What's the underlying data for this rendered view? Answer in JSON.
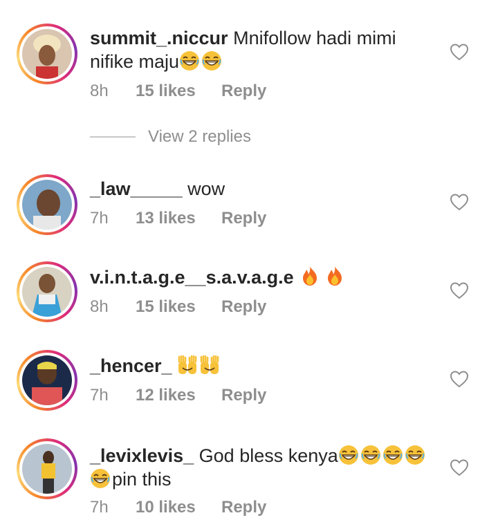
{
  "comments": [
    {
      "username": "summit_.niccur",
      "text_line1": "Mnifollow hadi mimi",
      "text_line2": "nifike maju",
      "emojis_line2": [
        "grin",
        "grin"
      ],
      "time": "8h",
      "likes": "15 likes",
      "reply": "Reply"
    },
    {
      "username": "_law_____",
      "text_line1": "wow",
      "time": "7h",
      "likes": "13 likes",
      "reply": "Reply"
    },
    {
      "username": "v.i.n.t.a.g.e__s.a.v.a.g.e",
      "emojis_line1": [
        "fire",
        "fire"
      ],
      "time": "8h",
      "likes": "15 likes",
      "reply": "Reply"
    },
    {
      "username": "_hencer_",
      "emojis_line1": [
        "raised-hands",
        "raised-hands"
      ],
      "time": "7h",
      "likes": "12 likes",
      "reply": "Reply"
    },
    {
      "username": "_levixlevis_",
      "text_line1": "God bless kenya",
      "emojis_line1": [
        "grin",
        "grin",
        "grin",
        "grin"
      ],
      "text_line2": "pin this",
      "emojis_line2": [
        "grin"
      ],
      "time": "7h",
      "likes": "10 likes",
      "reply": "Reply"
    }
  ],
  "view_replies": "View 2 replies",
  "icons": {
    "like": "heart-outline-icon",
    "emoji_grin": "grinning-face-icon",
    "emoji_fire": "fire-icon",
    "emoji_hands": "raised-hands-icon"
  },
  "colors": {
    "text": "#262626",
    "muted": "#8e8e8e",
    "story_ring": [
      "#f58529",
      "#dd2a7b",
      "#8134af"
    ]
  }
}
